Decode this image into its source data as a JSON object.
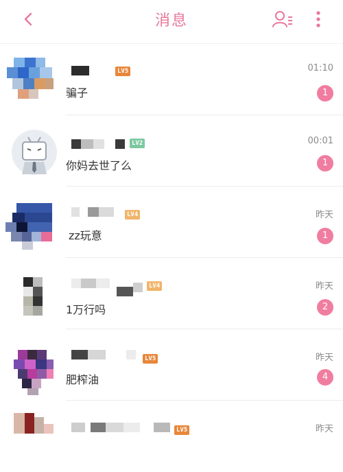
{
  "header": {
    "title": "消息",
    "accent": "#e8779a",
    "icons": [
      "back-icon",
      "contacts-icon",
      "more-icon"
    ]
  },
  "conversations": [
    {
      "level": "LV5",
      "level_color": "#e8863a",
      "message": "骗子",
      "time": "01:10",
      "unread": "1"
    },
    {
      "level": "LV2",
      "level_color": "#7cc8a0",
      "message": "你妈去世了么",
      "time": "00:01",
      "unread": "1"
    },
    {
      "level": "LV4",
      "level_color": "#f0b46a",
      "message": "zz玩意",
      "time": "昨天",
      "unread": "1"
    },
    {
      "level": "LV4",
      "level_color": "#f0b46a",
      "message": "1万行吗",
      "time": "昨天",
      "unread": "2"
    },
    {
      "level": "LV5",
      "level_color": "#e8863a",
      "message": "肥榨油",
      "time": "昨天",
      "unread": "4"
    },
    {
      "level": "LV5",
      "level_color": "#e8863a",
      "message": "",
      "time": "昨天",
      "unread": ""
    }
  ],
  "badge_color": "#f07d9f"
}
